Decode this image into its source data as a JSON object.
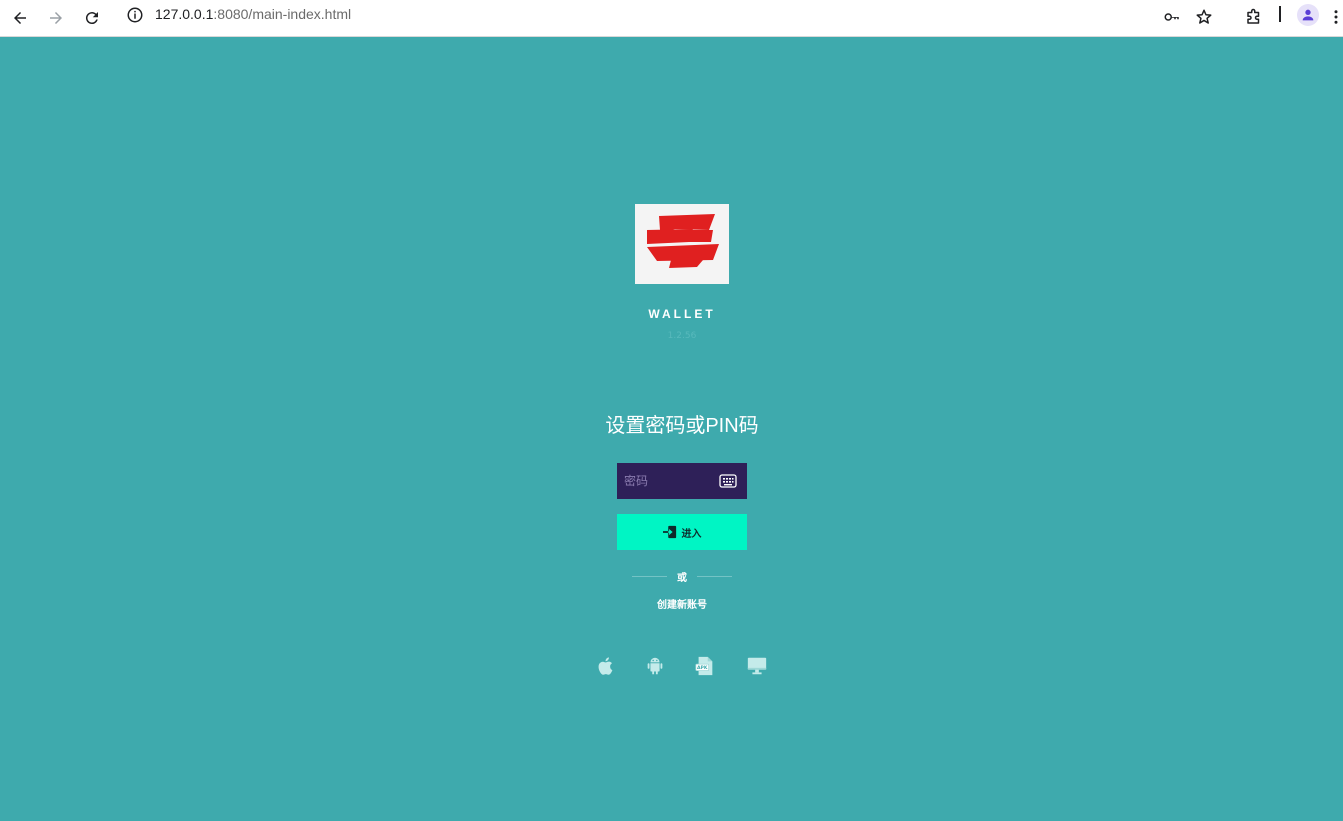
{
  "browser": {
    "url_host": "127.0.0.1",
    "url_rest": ":8080/main-index.html",
    "icons": [
      "back-icon",
      "forward-icon",
      "reload-icon",
      "info-icon",
      "key-icon",
      "star-icon",
      "extensions-icon",
      "profile-icon",
      "more-icon"
    ]
  },
  "app": {
    "brand": "WALLET",
    "version": "1.2.56",
    "heading": "设置密码或PIN码",
    "password_placeholder": "密码",
    "enter_label": "进入",
    "or_label": "或",
    "create_account_label": "创建新账号",
    "platforms": [
      "apple-icon",
      "android-icon",
      "apk-icon",
      "desktop-icon"
    ]
  },
  "colors": {
    "background": "#3eaaad",
    "input_bg": "#2e2058",
    "button_bg": "#00f5c4",
    "logo_red": "#e02020"
  }
}
